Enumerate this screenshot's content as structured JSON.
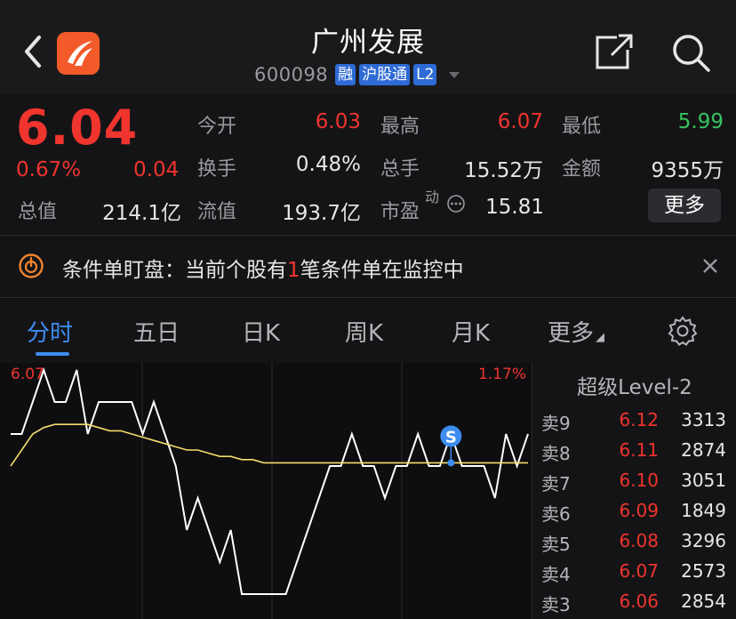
{
  "header": {
    "title": "广州发展",
    "code": "600098",
    "tags": [
      "融",
      "沪股通",
      "L2"
    ]
  },
  "quote": {
    "price": "6.04",
    "change_pct": "0.67%",
    "change": "0.04",
    "fields": {
      "open_label": "今开",
      "open": "6.03",
      "high_label": "最高",
      "high": "6.07",
      "low_label": "最低",
      "low": "5.99",
      "turnover_label": "换手",
      "turnover": "0.48%",
      "volume_label": "总手",
      "volume": "15.52万",
      "amount_label": "金额",
      "amount": "9355万",
      "mktcap_label": "总值",
      "mktcap": "214.1亿",
      "float_label": "流值",
      "float": "193.7亿",
      "pe_label": "市盈",
      "pe_sup": "动",
      "pe": "15.81"
    },
    "more_label": "更多"
  },
  "alert": {
    "text_prefix": "条件单盯盘：当前个股有",
    "count": "1",
    "text_suffix": "笔条件单在监控中"
  },
  "tabs": [
    {
      "label": "分时"
    },
    {
      "label": "五日"
    },
    {
      "label": "日K"
    },
    {
      "label": "周K"
    },
    {
      "label": "月K"
    },
    {
      "label": "更多"
    }
  ],
  "chart": {
    "hi_label": "6.07",
    "pct_label": "1.17%",
    "marker": "S"
  },
  "chart_data": {
    "type": "line",
    "ylim": [
      5.99,
      6.07
    ],
    "series": [
      {
        "values": [
          6.05,
          6.05,
          6.06,
          6.07,
          6.06,
          6.06,
          6.07,
          6.05,
          6.06,
          6.06,
          6.06,
          6.06,
          6.05,
          6.06,
          6.05,
          6.04,
          6.02,
          6.03,
          6.02,
          6.01,
          6.02,
          6.0,
          6.0,
          6.0,
          6.0,
          6.0,
          6.01,
          6.02,
          6.03,
          6.04,
          6.04,
          6.05,
          6.04,
          6.04,
          6.03,
          6.04,
          6.04,
          6.05,
          6.04,
          6.04,
          6.05,
          6.04,
          6.04,
          6.04,
          6.03,
          6.05,
          6.04,
          6.05
        ]
      },
      {
        "values": [
          6.04,
          6.045,
          6.05,
          6.052,
          6.053,
          6.053,
          6.053,
          6.053,
          6.052,
          6.051,
          6.051,
          6.05,
          6.049,
          6.048,
          6.047,
          6.046,
          6.045,
          6.045,
          6.044,
          6.043,
          6.043,
          6.042,
          6.042,
          6.041,
          6.041,
          6.041,
          6.041,
          6.041,
          6.041,
          6.041,
          6.041,
          6.041,
          6.041,
          6.041,
          6.041,
          6.041,
          6.041,
          6.041,
          6.041,
          6.041,
          6.041,
          6.041,
          6.041,
          6.041,
          6.041,
          6.041,
          6.041,
          6.041
        ]
      }
    ]
  },
  "book": {
    "title": "超级Level-2",
    "rows": [
      {
        "label": "卖9",
        "price": "6.12",
        "vol": "3313"
      },
      {
        "label": "卖8",
        "price": "6.11",
        "vol": "2874"
      },
      {
        "label": "卖7",
        "price": "6.10",
        "vol": "3051"
      },
      {
        "label": "卖6",
        "price": "6.09",
        "vol": "1849"
      },
      {
        "label": "卖5",
        "price": "6.08",
        "vol": "3296"
      },
      {
        "label": "卖4",
        "price": "6.07",
        "vol": "2573"
      },
      {
        "label": "卖3",
        "price": "6.06",
        "vol": "2854"
      }
    ]
  },
  "colors": {
    "up": "#f0342e",
    "down": "#37c45e",
    "accent": "#3d8cf0",
    "tag": "#2e6bd6",
    "avg_line": "#f2dc6b"
  }
}
